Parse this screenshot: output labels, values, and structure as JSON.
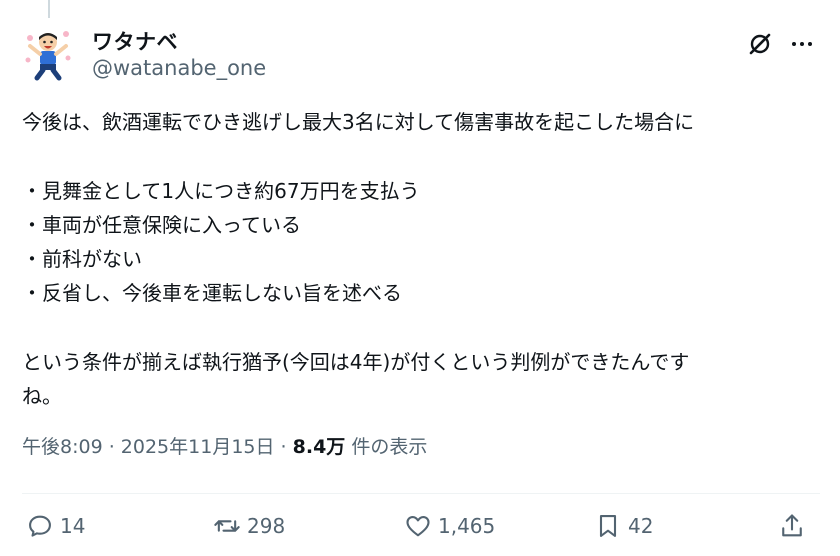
{
  "author": {
    "display_name": "ワタナベ",
    "handle": "@watanabe_one",
    "avatar_icon": "cartoon-boy-avatar"
  },
  "header_icons": {
    "grok": "grok-icon",
    "more": "more-icon"
  },
  "tweet": {
    "lines": [
      "今後は、飲酒運転でひき逃げし最大3名に対して傷害事故を起こした場合に",
      "",
      "・見舞金として1人につき約67万円を支払う",
      "・車両が任意保険に入っている",
      "・前科がない",
      "・反省し、今後車を運転しない旨を述べる",
      "",
      "という条件が揃えば執行猶予(今回は4年)が付くという判例ができたんです",
      "ね。"
    ]
  },
  "meta": {
    "time": "午後8:09",
    "separator1": " · ",
    "date": "2025年11月15日",
    "separator2": " · ",
    "views_count": "8.4万",
    "views_label": " 件の表示"
  },
  "actions": {
    "replies": "14",
    "reposts": "298",
    "likes": "1,465",
    "bookmarks": "42"
  },
  "colors": {
    "text": "#0f1419",
    "secondary": "#536471",
    "divider": "#eff3f4"
  }
}
